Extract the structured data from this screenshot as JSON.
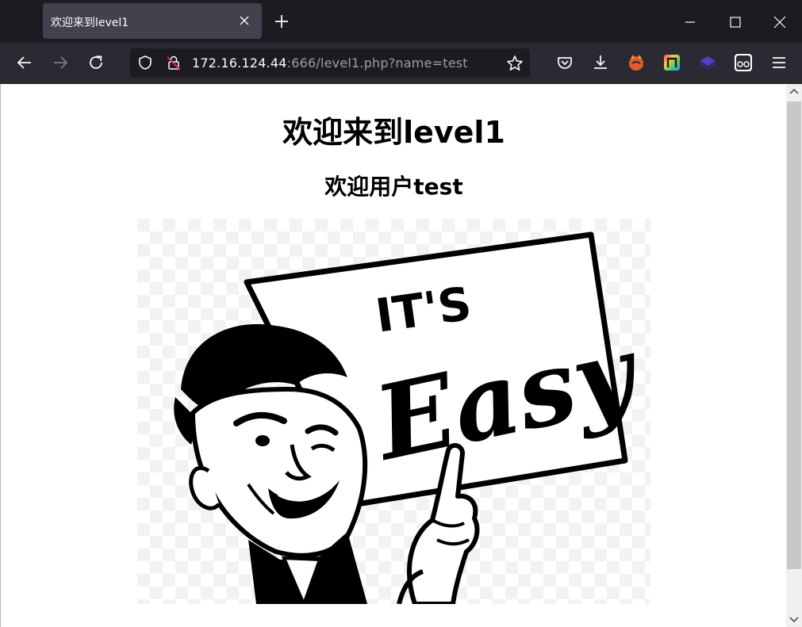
{
  "tab": {
    "title": "欢迎来到level1"
  },
  "urlbar": {
    "host": "172.16.124.44",
    "rest": ":666/level1.php?name=test"
  },
  "page": {
    "heading": "欢迎来到level1",
    "subheading": "欢迎用户test",
    "image": {
      "sign_top": "IT'S",
      "sign_main": "Easy"
    }
  },
  "icons": {
    "tab_close": "close-icon",
    "new_tab": "plus-icon",
    "minimize": "minimize-icon",
    "maximize": "maximize-icon",
    "close": "close-icon",
    "back": "arrow-left-icon",
    "forward": "arrow-right-icon",
    "reload": "reload-icon",
    "shield": "shield-icon",
    "insecure": "insecure-lock-icon",
    "bookmark": "star-icon",
    "pocket": "pocket-icon",
    "downloads": "download-icon",
    "ext1": "extension-fox-icon",
    "ext2": "extension-rainbow-icon",
    "ext3": "extension-layers-icon",
    "ext4": "extension-glasses-icon",
    "menu": "hamburger-menu-icon"
  },
  "colors": {
    "titlebar": "#1c1b22",
    "toolbar": "#2b2a33",
    "active_tab": "#42414d",
    "page": "#ffffff"
  }
}
